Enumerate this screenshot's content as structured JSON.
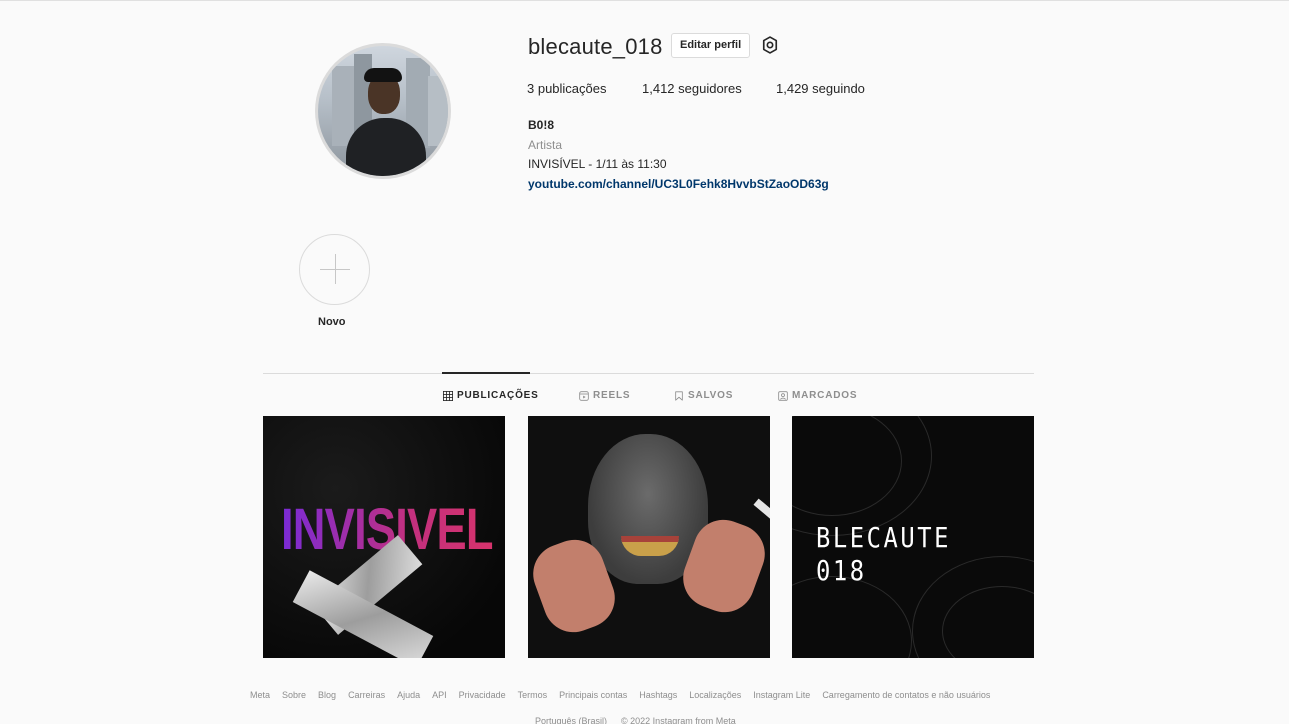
{
  "profile": {
    "username": "blecaute_018",
    "edit_label": "Editar perfil",
    "posts_label": "3 publicações",
    "followers_label": "1,412 seguidores",
    "following_label": "1,429 seguindo",
    "full_name": "B0!8",
    "category": "Artista",
    "bio": "INVISÍVEL - 1/11 às 11:30",
    "link": "youtube.com/channel/UC3L0Fehk8HvvbStZaoOD63g"
  },
  "highlight": {
    "label": "Novo"
  },
  "tabs": [
    {
      "label": "PUBLICAÇÕES",
      "icon": "grid-icon",
      "active": true
    },
    {
      "label": "REELS",
      "icon": "reels-icon",
      "active": false
    },
    {
      "label": "SALVOS",
      "icon": "bookmark-icon",
      "active": false
    },
    {
      "label": "MARCADOS",
      "icon": "tagged-icon",
      "active": false
    }
  ],
  "posts": [
    {
      "text": "INVISIVEL"
    },
    {
      "text": ""
    },
    {
      "text": "BLECAUTE 018"
    }
  ],
  "footer": {
    "links": [
      "Meta",
      "Sobre",
      "Blog",
      "Carreiras",
      "Ajuda",
      "API",
      "Privacidade",
      "Termos",
      "Principais contas",
      "Hashtags",
      "Localizações",
      "Instagram Lite",
      "Carregamento de contatos e não usuários"
    ],
    "language": "Português (Brasil)",
    "copyright": "© 2022 Instagram from Meta"
  },
  "colors": {
    "background": "#fafafa",
    "text": "#262626",
    "secondary": "#8e8e8e",
    "link": "#00376b",
    "border": "#dbdbdb"
  }
}
